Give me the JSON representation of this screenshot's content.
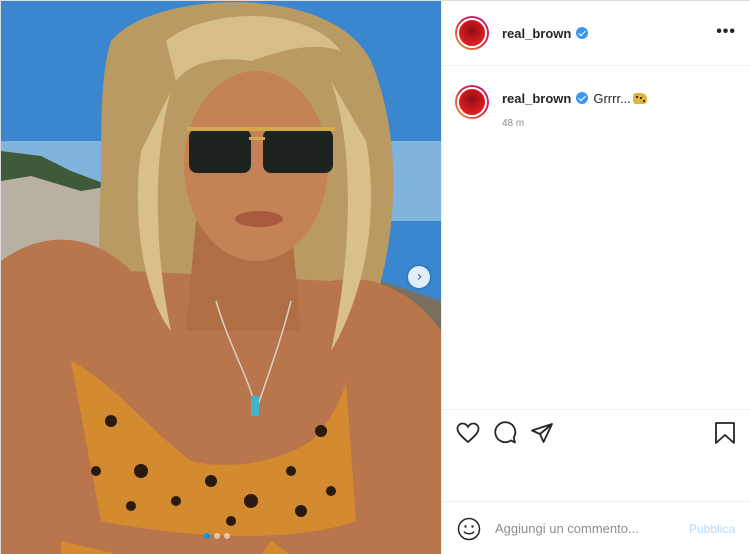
{
  "post": {
    "username": "real_brown",
    "verified": true,
    "caption_text": "Grrrr...",
    "caption_emoji": "leopard-emoji",
    "timestamp": "48 m"
  },
  "media": {
    "slide_count": 3,
    "active_slide": 1
  },
  "actions": {
    "like_icon": "heart-icon",
    "comment_icon": "comment-icon",
    "share_icon": "paper-plane-icon",
    "save_icon": "bookmark-icon"
  },
  "comment_box": {
    "placeholder": "Aggiungi un commento...",
    "publish_label": "Pubblica"
  },
  "colors": {
    "accent": "#0095f6",
    "publish_disabled": "#b3dbff",
    "verified_badge": "#3897f0"
  }
}
